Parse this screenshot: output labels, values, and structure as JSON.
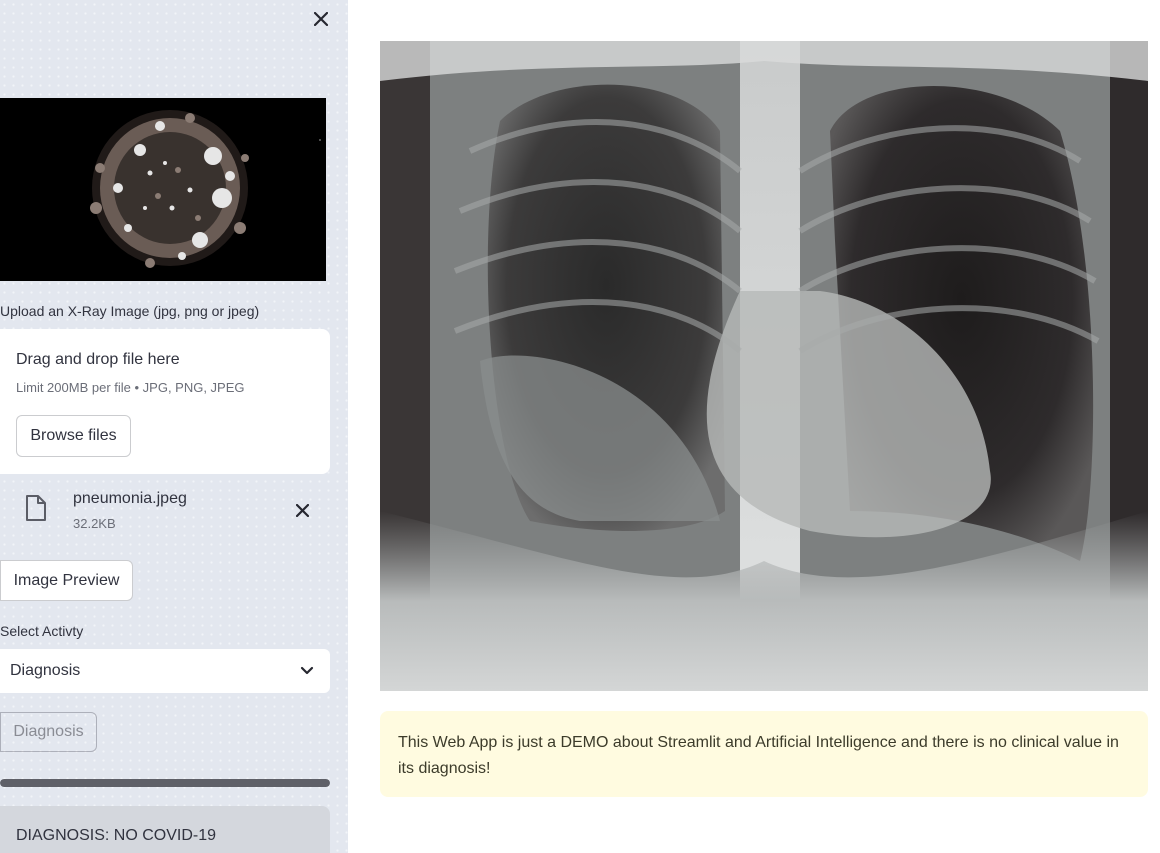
{
  "sidebar": {
    "close_icon": "close-icon",
    "image_icon": "coronavirus-illustration",
    "upload_label": "Upload an X-Ray Image (jpg, png or jpeg)",
    "dropzone_title": "Drag and drop file here",
    "dropzone_limit": "Limit 200MB per file • JPG, PNG, JPEG",
    "browse_label": "Browse files",
    "file": {
      "icon": "file-icon",
      "name": "pneumonia.jpeg",
      "size": "32.2KB",
      "remove_icon": "close-icon"
    },
    "preview_label": "Image Preview",
    "select_label": "Select Activty",
    "select_value": "Diagnosis",
    "diagnosis_button_label": "Diagnosis",
    "progress": 1.0,
    "result_text": "DIAGNOSIS: NO COVID-19"
  },
  "main": {
    "image": "chest-xray",
    "warning_text": "This Web App is just a DEMO about Streamlit and Artificial Intelligence and there is no clinical value in its diagnosis!"
  },
  "colors": {
    "sidebar_bg": "#e3e7ef",
    "warning_bg": "#fffbe0",
    "result_bg": "#d4d7dd",
    "progress_fill": "#5f6068"
  }
}
